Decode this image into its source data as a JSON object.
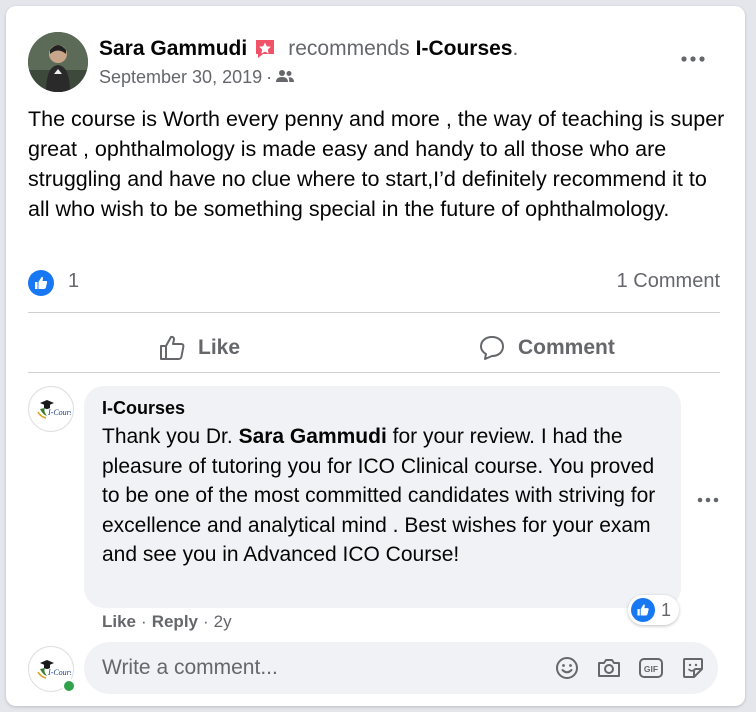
{
  "post": {
    "author_name": "Sara Gammudi",
    "recommends_text": "recommends",
    "page_name": "I-Courses",
    "period": ".",
    "date": "September 30, 2019",
    "meta_separator": "·",
    "audience_icon": "friends-icon",
    "text": "The course is Worth every penny and more , the way of teaching is super great , ophthalmology is made easy and handy to all those who are struggling and have no clue where to start,I’d definitely recommend it to all who wish to be something special in the future of ophthalmology.",
    "like_count": "1",
    "comment_count": "1 Comment"
  },
  "actions": {
    "like_label": "Like",
    "comment_label": "Comment"
  },
  "comment": {
    "author": "I-Courses",
    "text_before": "Thank you Dr. ",
    "text_bold": "Sara Gammudi",
    "text_after": " for your review. I had the pleasure of tutoring you for ICO Clinical course. You proved to be one of the most committed candidates with striving for excellence and analytical mind . Best wishes for your exam and see you in Advanced ICO Course!",
    "reaction_count": "1",
    "like_action": "Like",
    "reply_action": "Reply",
    "separator": "·",
    "age": "2y",
    "avatar_logo_text": "I-Courses"
  },
  "composer": {
    "placeholder": "Write a comment...",
    "icons": [
      "emoji-icon",
      "camera-icon",
      "gif-icon",
      "sticker-icon"
    ],
    "gif_label": "GIF"
  },
  "colors": {
    "facebook_blue": "#1877f2",
    "recommend_badge": "#f25268",
    "secondary_text": "#65676b",
    "online_green": "#31a24c"
  }
}
